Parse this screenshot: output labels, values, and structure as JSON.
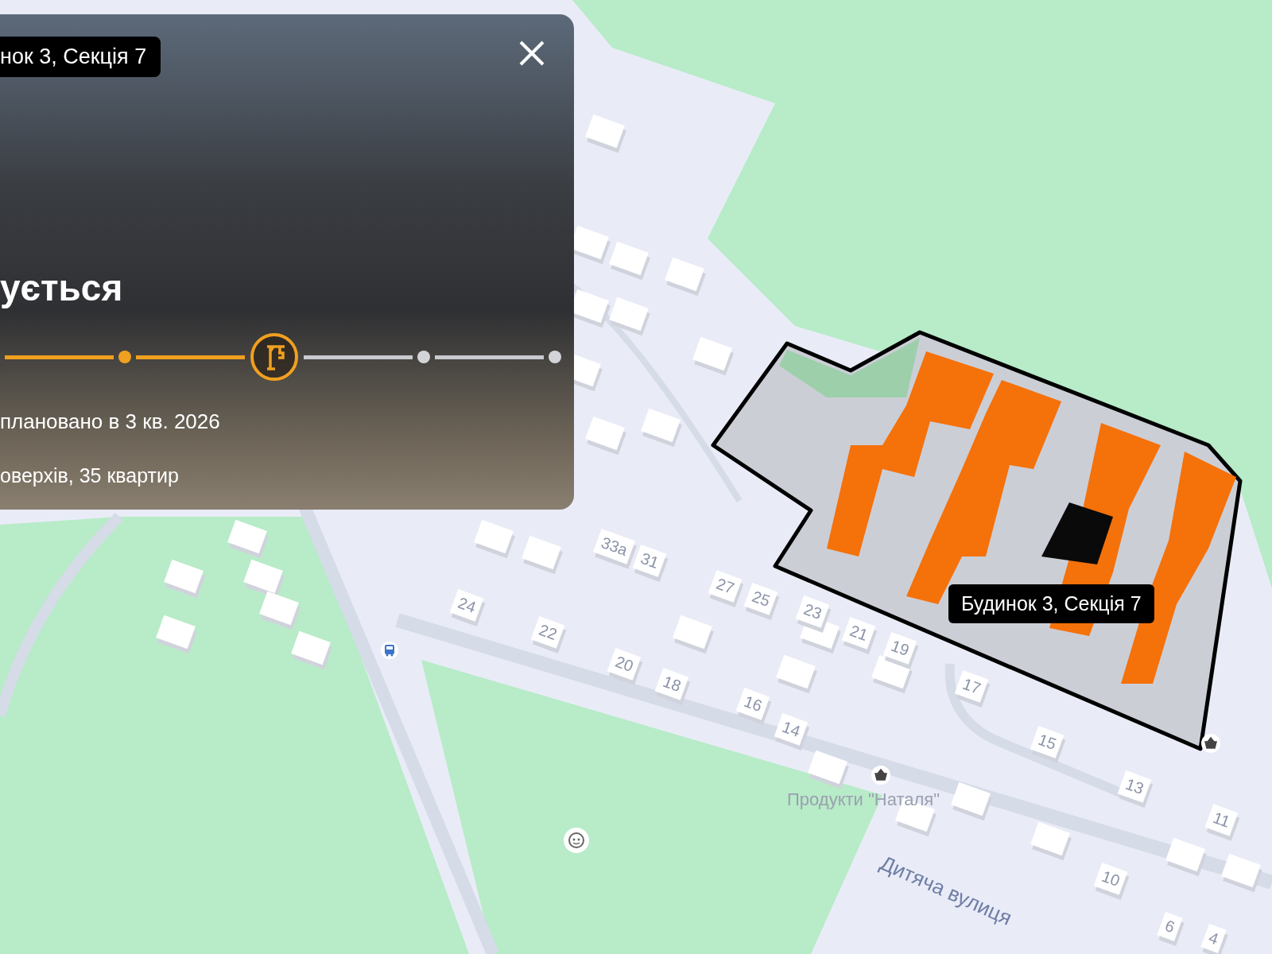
{
  "card": {
    "section_label": "нок 3, Секція 7",
    "status": "ується",
    "progress": [
      {
        "kind": "done"
      },
      {
        "kind": "current"
      },
      {
        "kind": "todo"
      },
      {
        "kind": "todo"
      }
    ],
    "completion": "плановано в 3 кв. 2026",
    "details": "оверхів, 35 квартир"
  },
  "map": {
    "house_numbers": [
      "33а",
      "31",
      "27",
      "25",
      "23",
      "21",
      "19",
      "17",
      "24",
      "22",
      "20",
      "18",
      "16",
      "14",
      "15",
      "13",
      "11",
      "10",
      "6",
      "4"
    ],
    "poi_label": "Продукти \"Наталя\"",
    "street_label": "Дитяча вулиця",
    "section_tooltip": "Будинок 3, Секція 7",
    "pois": [
      {
        "kind": "shop"
      },
      {
        "kind": "shop"
      },
      {
        "kind": "bus"
      },
      {
        "kind": "playground"
      }
    ]
  }
}
